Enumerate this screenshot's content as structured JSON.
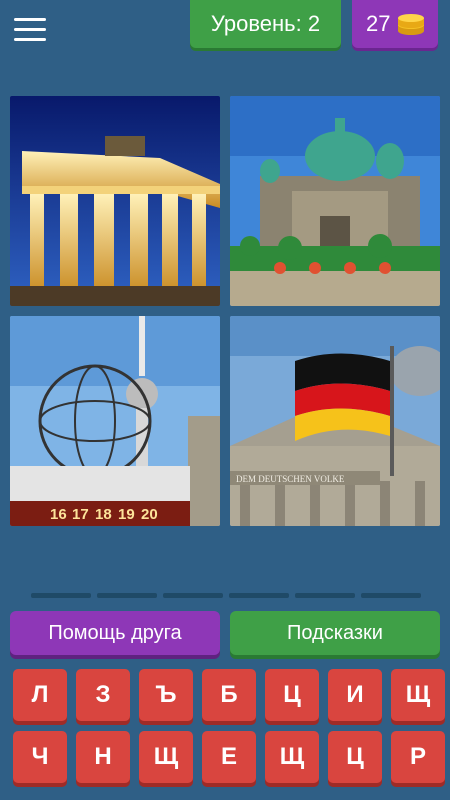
{
  "header": {
    "level_label": "Уровень: 2",
    "coins": "27",
    "menu_icon": "hamburger-menu-icon",
    "coin_icon": "coin-stack-icon"
  },
  "answer": {
    "slot_count": 6
  },
  "buttons": {
    "friend_help": "Помощь друга",
    "hints": "Подсказки"
  },
  "photos": {
    "panel_4_inscription": "DEM DEUTSCHEN VOLKE",
    "panel_3_clock_digits": [
      "16",
      "17",
      "18",
      "19",
      "20"
    ]
  },
  "keyboard": {
    "row1": [
      "Л",
      "З",
      "Ъ",
      "Б",
      "Ц",
      "И",
      "Щ"
    ],
    "row2": [
      "Ч",
      "Н",
      "Щ",
      "Е",
      "Щ",
      "Ц",
      "Р"
    ]
  },
  "colors": {
    "background": "#2f5f86",
    "green": "#3fa047",
    "purple": "#8e37b7",
    "key_red": "#d9453f"
  }
}
